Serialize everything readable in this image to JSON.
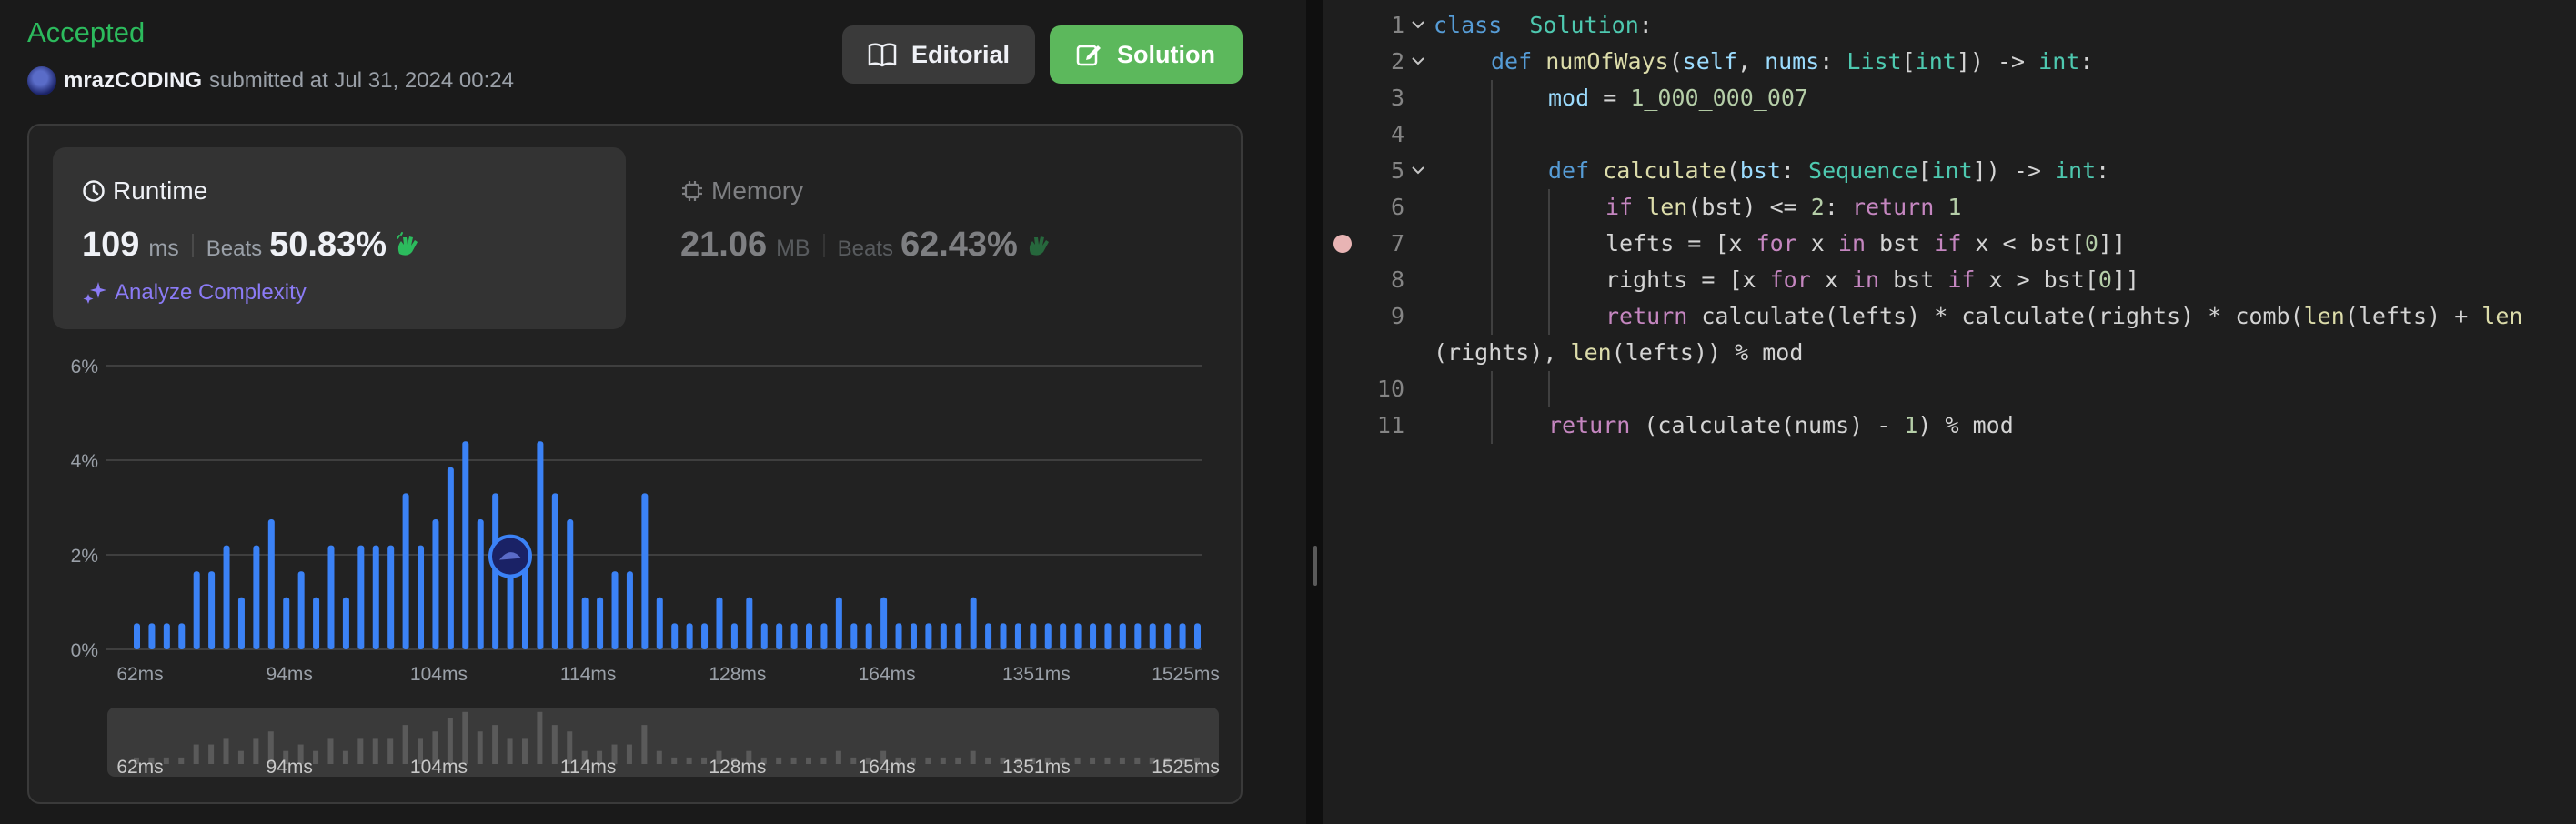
{
  "submission": {
    "status": "Accepted",
    "username": "mrazCODING",
    "submitted_text": "submitted at Jul 31, 2024 00:24",
    "editorial_label": "Editorial",
    "solution_label": "Solution"
  },
  "runtime": {
    "title": "Runtime",
    "value": "109",
    "unit": "ms",
    "beats_label": "Beats",
    "beats_pct": "50.83%",
    "analyze_label": "Analyze Complexity"
  },
  "memory": {
    "title": "Memory",
    "value": "21.06",
    "unit": "MB",
    "beats_label": "Beats",
    "beats_pct": "62.43%"
  },
  "colors": {
    "accepted": "#2cbb5d",
    "bar": "#3b82f6",
    "solution_button": "#5cb85c",
    "analyze": "#8b7bf5"
  },
  "icons": {
    "editorial": "book-icon",
    "solution": "edit-icon",
    "runtime": "clock-icon",
    "memory": "chip-icon",
    "analyze": "sparkle-icon",
    "beats": "clapping-hands-icon"
  },
  "chart_data": {
    "type": "bar",
    "ylim": [
      0,
      6
    ],
    "y_ticks": [
      "6%",
      "4%",
      "2%",
      "0%"
    ],
    "y_tick_values": [
      6,
      4,
      2,
      0
    ],
    "x_tick_labels": [
      "62ms",
      "94ms",
      "104ms",
      "114ms",
      "128ms",
      "164ms",
      "1351ms",
      "1525ms"
    ],
    "x_tick_bar_index": [
      0,
      10,
      20,
      30,
      40,
      50,
      60,
      70
    ],
    "values": [
      0.55,
      0.55,
      0.55,
      0.55,
      1.65,
      1.65,
      2.2,
      1.1,
      2.2,
      2.75,
      1.1,
      1.65,
      1.1,
      2.2,
      1.1,
      2.2,
      2.2,
      2.2,
      3.3,
      2.2,
      2.75,
      3.85,
      4.4,
      2.75,
      3.3,
      2.2,
      2.2,
      4.4,
      3.3,
      2.75,
      1.1,
      1.1,
      1.65,
      1.65,
      3.3,
      1.1,
      0.55,
      0.55,
      0.55,
      1.1,
      0.55,
      1.1,
      0.55,
      0.55,
      0.55,
      0.55,
      0.55,
      1.1,
      0.55,
      0.55,
      1.1,
      0.55,
      0.55,
      0.55,
      0.55,
      0.55,
      1.1,
      0.55,
      0.55,
      0.55,
      0.55,
      0.55,
      0.55,
      0.55,
      0.55,
      0.55,
      0.55,
      0.55,
      0.55,
      0.55,
      0.55,
      0.55
    ],
    "highlight_index": 26,
    "grid": true
  },
  "editor": {
    "lines": [
      {
        "n": "1",
        "fold": true,
        "indent": 0,
        "tokens": [
          [
            "kw",
            "class"
          ],
          [
            "",
            "  "
          ],
          [
            "cls",
            "Solution"
          ],
          [
            "",
            ":"
          ]
        ]
      },
      {
        "n": "2",
        "fold": true,
        "indent": 1,
        "tokens": [
          [
            "kw",
            "def"
          ],
          [
            "",
            " "
          ],
          [
            "fn",
            "numOfWays"
          ],
          [
            "",
            "("
          ],
          [
            "var",
            "self"
          ],
          [
            "",
            ", "
          ],
          [
            "var",
            "nums"
          ],
          [
            "",
            ": "
          ],
          [
            "cls",
            "List"
          ],
          [
            "",
            "["
          ],
          [
            "cls",
            "int"
          ],
          [
            "",
            "]) -> "
          ],
          [
            "cls",
            "int"
          ],
          [
            "",
            ":"
          ]
        ]
      },
      {
        "n": "3",
        "fold": false,
        "indent": 2,
        "tokens": [
          [
            "var",
            "mod"
          ],
          [
            "",
            " = "
          ],
          [
            "num",
            "1_000_000_007"
          ]
        ]
      },
      {
        "n": "4",
        "fold": false,
        "indent": 2,
        "tokens": []
      },
      {
        "n": "5",
        "fold": true,
        "indent": 2,
        "tokens": [
          [
            "kw",
            "def"
          ],
          [
            "",
            " "
          ],
          [
            "fn",
            "calculate"
          ],
          [
            "",
            "("
          ],
          [
            "var",
            "bst"
          ],
          [
            "",
            ": "
          ],
          [
            "cls",
            "Sequence"
          ],
          [
            "",
            "["
          ],
          [
            "cls",
            "int"
          ],
          [
            "",
            "]) -> "
          ],
          [
            "cls",
            "int"
          ],
          [
            "",
            ":"
          ]
        ]
      },
      {
        "n": "6",
        "fold": false,
        "indent": 3,
        "tokens": [
          [
            "kw2",
            "if"
          ],
          [
            "",
            " "
          ],
          [
            "bi",
            "len"
          ],
          [
            "",
            "(bst) <= "
          ],
          [
            "num",
            "2"
          ],
          [
            "",
            ": "
          ],
          [
            "kw2",
            "return"
          ],
          [
            "",
            " "
          ],
          [
            "num",
            "1"
          ]
        ]
      },
      {
        "n": "7",
        "fold": false,
        "indent": 3,
        "tokens": [
          [
            "",
            "lefts = [x "
          ],
          [
            "kw2",
            "for"
          ],
          [
            "",
            " x "
          ],
          [
            "kw2",
            "in"
          ],
          [
            "",
            " bst "
          ],
          [
            "kw2",
            "if"
          ],
          [
            "",
            " x < bst["
          ],
          [
            "num",
            "0"
          ],
          [
            "",
            "]]"
          ]
        ]
      },
      {
        "n": "8",
        "fold": false,
        "indent": 3,
        "tokens": [
          [
            "",
            "rights = [x "
          ],
          [
            "kw2",
            "for"
          ],
          [
            "",
            " x "
          ],
          [
            "kw2",
            "in"
          ],
          [
            "",
            " bst "
          ],
          [
            "kw2",
            "if"
          ],
          [
            "",
            " x > bst["
          ],
          [
            "num",
            "0"
          ],
          [
            "",
            "]]"
          ]
        ]
      },
      {
        "n": "9",
        "fold": false,
        "indent": 3,
        "tokens": [
          [
            "kw2",
            "return"
          ],
          [
            "",
            " calculate(lefts) * calculate(rights) * comb("
          ],
          [
            "bi",
            "len"
          ],
          [
            "",
            "(lefts) + "
          ],
          [
            "bi",
            "len"
          ]
        ]
      },
      {
        "n": "",
        "fold": false,
        "indent": 0,
        "tokens": [
          [
            "",
            "(rights), "
          ],
          [
            "bi",
            "len"
          ],
          [
            "",
            "(lefts)) % mod"
          ]
        ]
      },
      {
        "n": "10",
        "fold": false,
        "indent": 3,
        "tokens": []
      },
      {
        "n": "11",
        "fold": false,
        "indent": 2,
        "tokens": [
          [
            "kw2",
            "return"
          ],
          [
            "",
            " (calculate(nums) - "
          ],
          [
            "num",
            "1"
          ],
          [
            "",
            ") % mod"
          ]
        ]
      }
    ]
  }
}
